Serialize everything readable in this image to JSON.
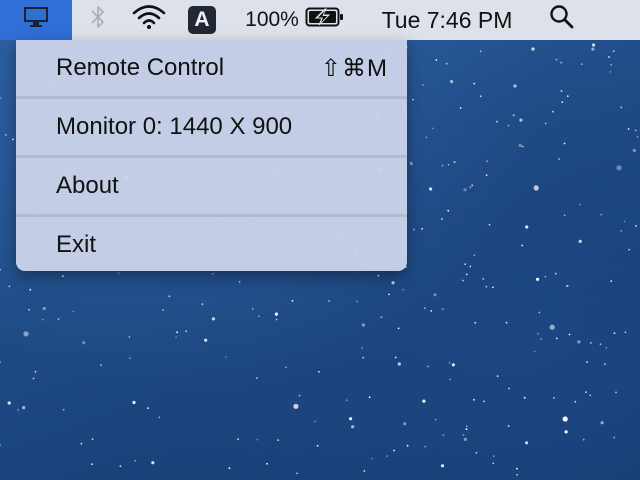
{
  "menubar": {
    "app_icon": "monitor-icon",
    "bluetooth_icon": "bluetooth-icon",
    "wifi_icon": "wifi-icon",
    "input_source": "A",
    "battery_percent": "100%",
    "battery_icon": "battery-charging-icon",
    "clock": "Tue 7:46 PM",
    "search_icon": "search-icon"
  },
  "menu": {
    "items": [
      {
        "label": "Remote Control",
        "shortcut": "⇧⌘M"
      },
      {
        "label": "Monitor 0: 1440 X 900"
      },
      {
        "label": "About"
      },
      {
        "label": "Exit"
      }
    ]
  },
  "colors": {
    "menubar_bg": "#dde1ea",
    "app_highlight": "#2f6fd6",
    "menu_bg": "#c8d2e8",
    "desktop_bg": "#1f4b86"
  }
}
